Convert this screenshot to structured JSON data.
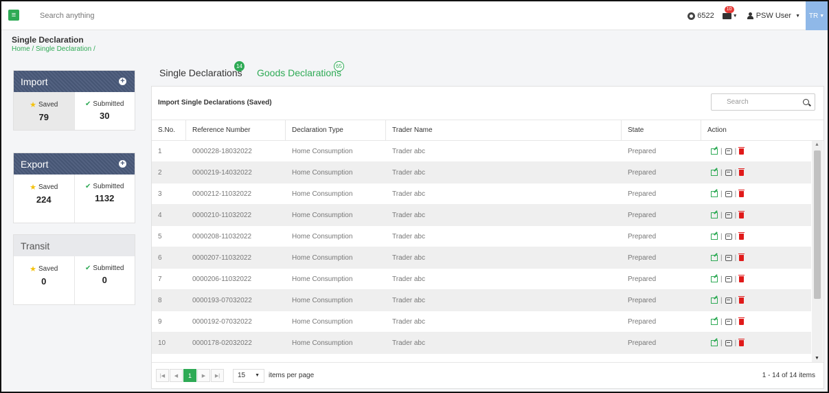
{
  "header": {
    "search_placeholder": "Search anything",
    "credits": "6522",
    "mail_badge": "10",
    "user_name": "PSW User",
    "language": "TR"
  },
  "page": {
    "title": "Single Declaration",
    "breadcrumb": "Home / Single Declaration /"
  },
  "sidebar": {
    "import": {
      "title": "Import",
      "saved_label": "Saved",
      "saved_value": "79",
      "submitted_label": "Submitted",
      "submitted_value": "30"
    },
    "export": {
      "title": "Export",
      "saved_label": "Saved",
      "saved_value": "224",
      "submitted_label": "Submitted",
      "submitted_value": "1132"
    },
    "transit": {
      "title": "Transit",
      "saved_label": "Saved",
      "saved_value": "0",
      "submitted_label": "Submitted",
      "submitted_value": "0"
    }
  },
  "tabs": [
    {
      "label": "Single Declarations",
      "count": "14"
    },
    {
      "label": "Goods Declarations",
      "count": "65"
    }
  ],
  "table": {
    "title": "Import Single Declarations (Saved)",
    "search_placeholder": "Search",
    "columns": [
      "S.No.",
      "Reference Number",
      "Declaration Type",
      "Trader Name",
      "State",
      "Action"
    ],
    "rows": [
      [
        "1",
        "0000228-18032022",
        "Home Consumption",
        "Trader abc",
        "Prepared"
      ],
      [
        "2",
        "0000219-14032022",
        "Home Consumption",
        "Trader abc",
        "Prepared"
      ],
      [
        "3",
        "0000212-11032022",
        "Home Consumption",
        "Trader abc",
        "Prepared"
      ],
      [
        "4",
        "0000210-11032022",
        "Home Consumption",
        "Trader abc",
        "Prepared"
      ],
      [
        "5",
        "0000208-11032022",
        "Home Consumption",
        "Trader abc",
        "Prepared"
      ],
      [
        "6",
        "0000207-11032022",
        "Home Consumption",
        "Trader abc",
        "Prepared"
      ],
      [
        "7",
        "0000206-11032022",
        "Home Consumption",
        "Trader abc",
        "Prepared"
      ],
      [
        "8",
        "0000193-07032022",
        "Home Consumption",
        "Trader abc",
        "Prepared"
      ],
      [
        "9",
        "0000192-07032022",
        "Home Consumption",
        "Trader abc",
        "Prepared"
      ],
      [
        "10",
        "0000178-02032022",
        "Home Consumption",
        "Trader abc",
        "Prepared"
      ]
    ],
    "action_separator": "|"
  },
  "pager": {
    "current_page": "1",
    "per_page": "15",
    "per_page_label": "items per page",
    "range": "1 - 14 of 14 items"
  }
}
